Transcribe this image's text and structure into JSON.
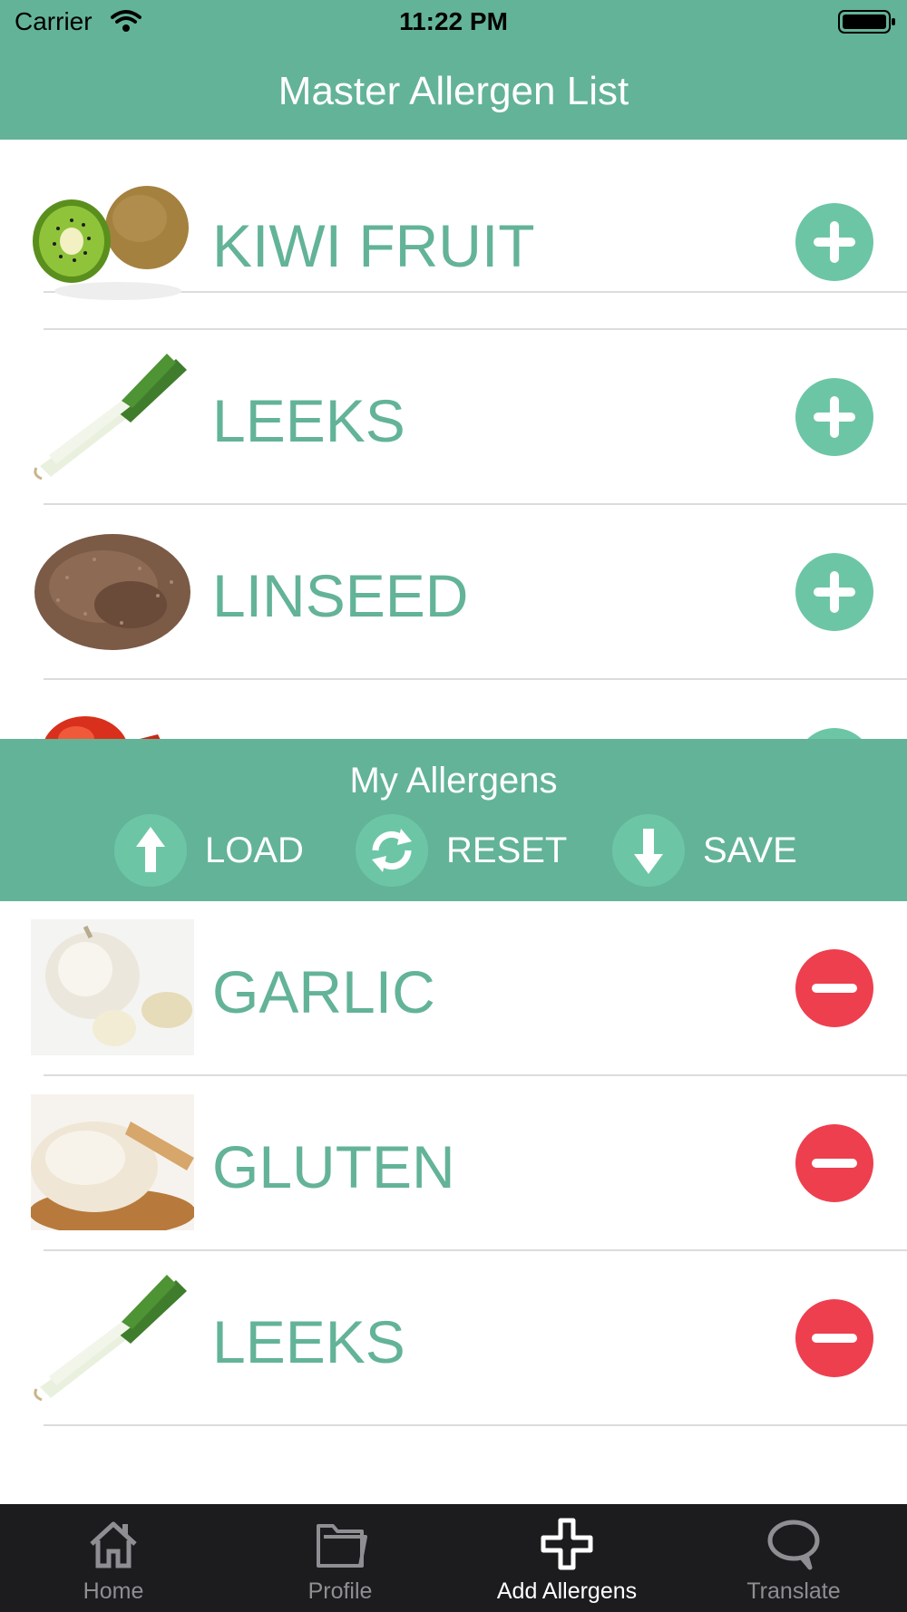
{
  "status_bar": {
    "carrier": "Carrier",
    "time": "11:22 PM"
  },
  "nav": {
    "title": "Master Allergen List"
  },
  "master_list": {
    "items": [
      {
        "label": "KIWI FRUIT",
        "image": "kiwi-fruit-photo",
        "action_icon": "plus-icon"
      },
      {
        "label": "LEEKS",
        "image": "leeks-photo",
        "action_icon": "plus-icon"
      },
      {
        "label": "LINSEED",
        "image": "linseed-photo",
        "action_icon": "plus-icon"
      },
      {
        "label": "",
        "image": "lobster-photo",
        "action_icon": "plus-icon"
      }
    ]
  },
  "my_allergens": {
    "title": "My Allergens",
    "load_label": "LOAD",
    "reset_label": "RESET",
    "save_label": "SAVE",
    "items": [
      {
        "label": "GARLIC",
        "image": "garlic-photo",
        "action_icon": "minus-icon"
      },
      {
        "label": "GLUTEN",
        "image": "dough-photo",
        "action_icon": "minus-icon"
      },
      {
        "label": "LEEKS",
        "image": "leeks-photo",
        "action_icon": "minus-icon"
      }
    ]
  },
  "tabs": [
    {
      "label": "Home",
      "icon": "house-icon",
      "active": false
    },
    {
      "label": "Profile",
      "icon": "folder-icon",
      "active": false
    },
    {
      "label": "Add Allergens",
      "icon": "plus-outline-icon",
      "active": true
    },
    {
      "label": "Translate",
      "icon": "speech-bubble-icon",
      "active": false
    }
  ],
  "colors": {
    "primary": "#63b398",
    "accent": "#6cc6a6",
    "remove": "#ee3f4f",
    "tab_bar": "#1c1c1e"
  }
}
